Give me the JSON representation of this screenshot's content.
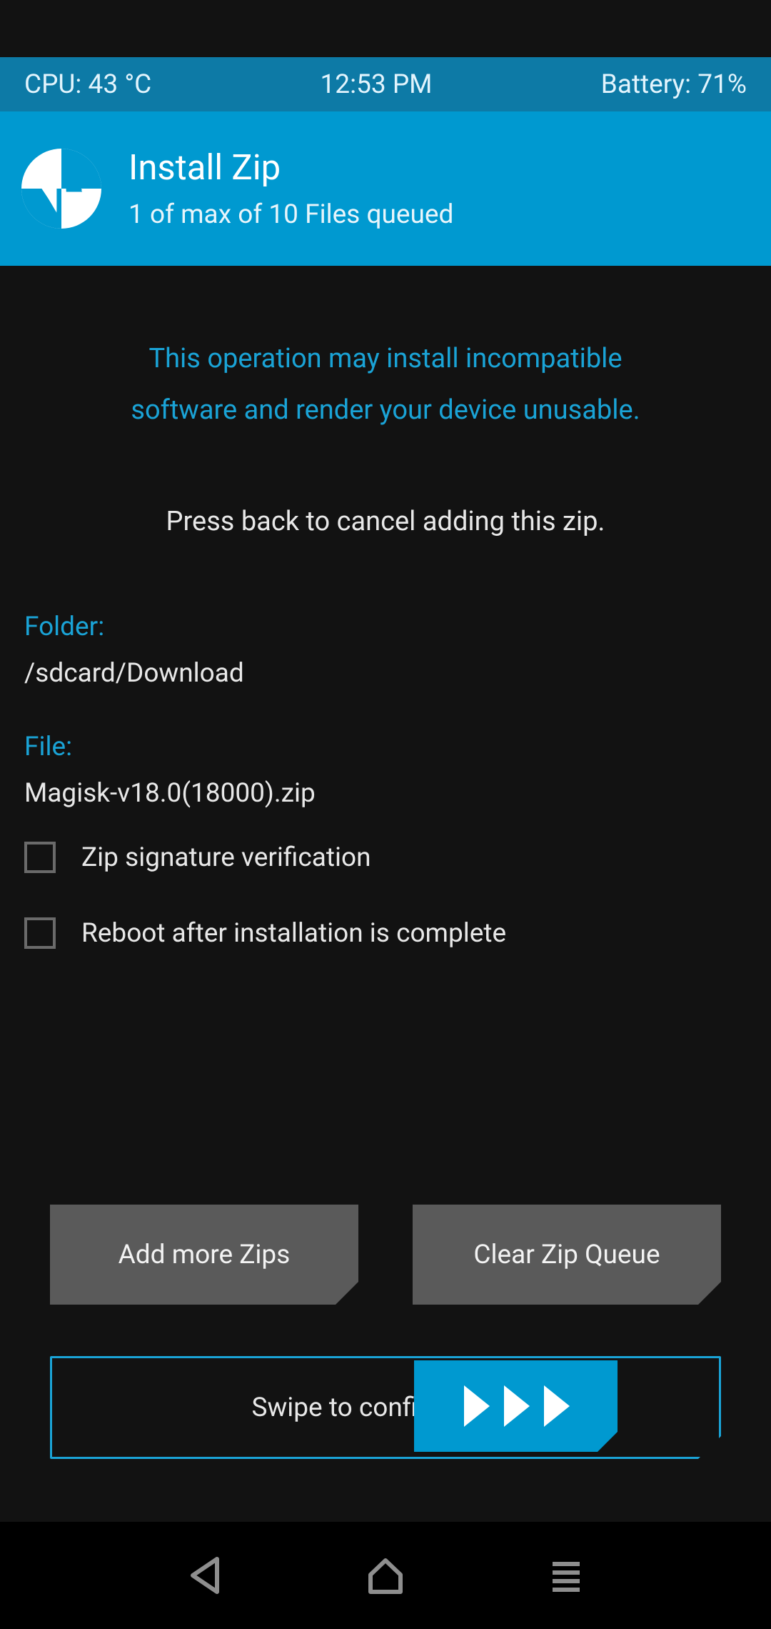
{
  "status": {
    "cpu": "CPU: 43 °C",
    "time": "12:53 PM",
    "battery": "Battery: 71%"
  },
  "header": {
    "title": "Install Zip",
    "subtitle": "1 of max of 10 Files queued"
  },
  "warning": {
    "line1": "This operation may install incompatible",
    "line2": "software and render your device unusable."
  },
  "instruction": "Press back to cancel adding this zip.",
  "folder_label": "Folder:",
  "folder_value": "/sdcard/Download",
  "file_label": "File:",
  "file_value": "Magisk-v18.0(18000).zip",
  "checkbox1_label": "Zip signature verification",
  "checkbox2_label": "Reboot after installation is complete",
  "buttons": {
    "add_more": "Add more Zips",
    "clear_queue": "Clear Zip Queue"
  },
  "swipe_label": "Swipe to confirm Flash"
}
